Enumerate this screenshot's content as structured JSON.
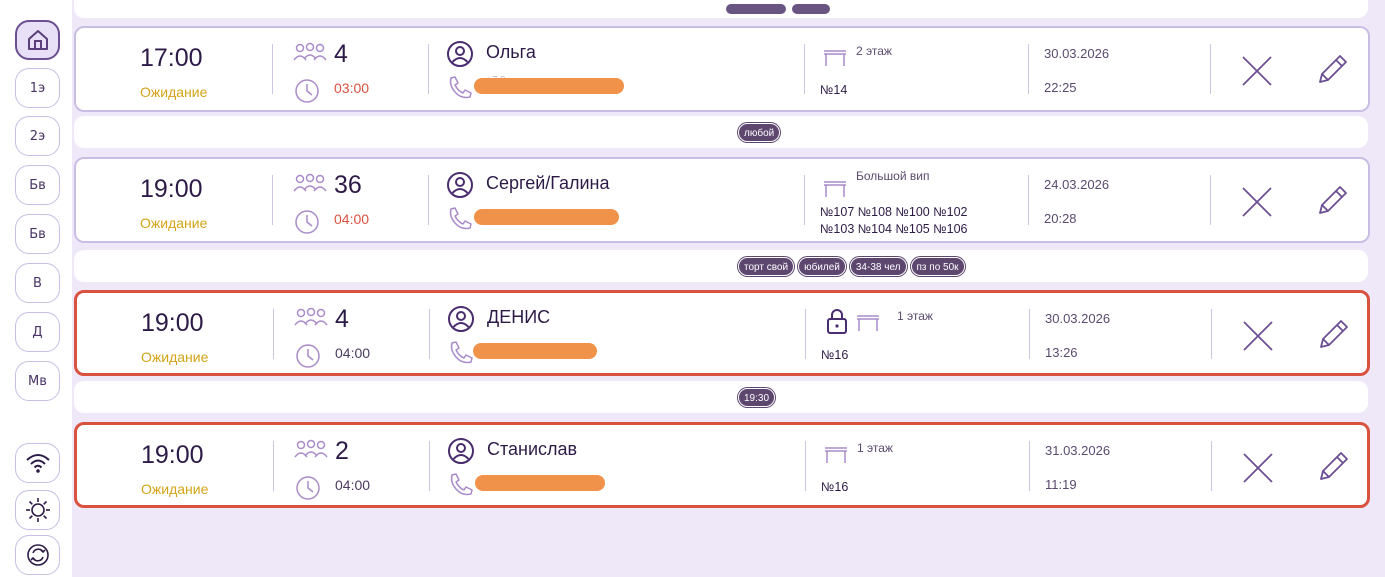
{
  "sidebar": {
    "items": [
      {
        "label": "",
        "icon": "home-icon"
      },
      {
        "label": "1э"
      },
      {
        "label": "2э"
      },
      {
        "label": "Бв"
      },
      {
        "label": "Бв"
      },
      {
        "label": "В"
      },
      {
        "label": "Д"
      },
      {
        "label": "Мв"
      }
    ],
    "bottom": [
      {
        "icon": "wifi-icon"
      },
      {
        "icon": "sun-icon"
      },
      {
        "icon": "refresh-icon"
      }
    ]
  },
  "reservations": [
    {
      "time": "17:00",
      "status": "Ожидание",
      "guests": "4",
      "duration": "03:00",
      "name": "Ольга",
      "phone_hint": "+7 9",
      "hall": "2 этаж",
      "tables": [
        "№14"
      ],
      "date": "30.03.2026",
      "created": "22:25",
      "locked": false,
      "tags": [
        "любой"
      ]
    },
    {
      "time": "19:00",
      "status": "Ожидание",
      "guests": "36",
      "duration": "04:00",
      "name": "Сергей/Галина",
      "hall": "Большой вип",
      "tables": [
        "№107 №108 №100 №102",
        "№103 №104 №105 №106"
      ],
      "date": "24.03.2026",
      "created": "20:28",
      "locked": false,
      "tags": [
        "торт свой",
        "юбилей",
        "34-38 чел",
        "пз по 50к"
      ]
    },
    {
      "time": "19:00",
      "status": "Ожидание",
      "guests": "4",
      "duration": "04:00",
      "name": "ДЕНИС",
      "hall": "1 этаж",
      "tables": [
        "№16"
      ],
      "date": "30.03.2026",
      "created": "13:26",
      "locked": true,
      "tags": [
        "19:30"
      ]
    },
    {
      "time": "19:00",
      "status": "Ожидание",
      "guests": "2",
      "duration": "04:00",
      "name": "Станислав",
      "hall": "1 этаж",
      "tables": [
        "№16"
      ],
      "date": "31.03.2026",
      "created": "11:19",
      "locked": false,
      "tags": []
    }
  ],
  "colors": {
    "accent": "#6c4f92",
    "status": "#d4a418",
    "alert_border": "#d9523f",
    "redaction": "#f0924a",
    "background": "#efe8f9"
  }
}
